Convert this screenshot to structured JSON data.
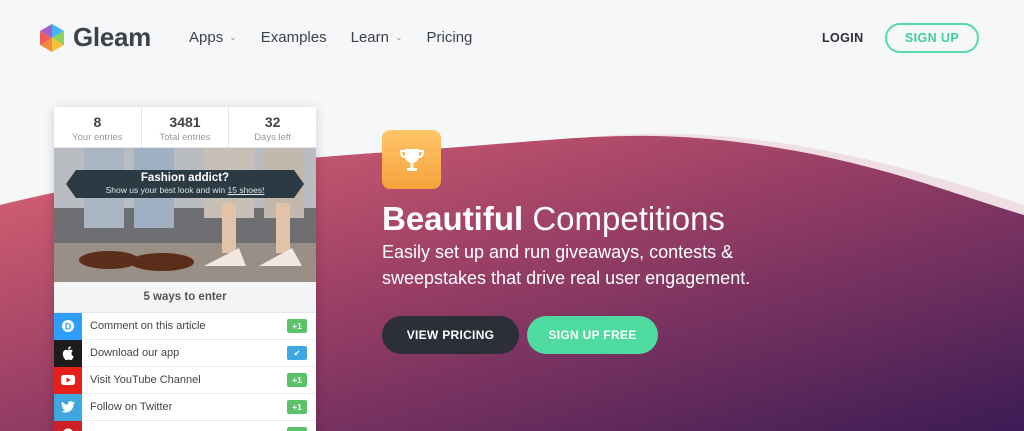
{
  "header": {
    "logo_text": "Gleam",
    "nav": [
      {
        "label": "Apps",
        "has_dropdown": true
      },
      {
        "label": "Examples",
        "has_dropdown": false
      },
      {
        "label": "Learn",
        "has_dropdown": true
      },
      {
        "label": "Pricing",
        "has_dropdown": false
      }
    ],
    "login_label": "LOGIN",
    "signup_label": "SIGN UP"
  },
  "widget": {
    "stats": [
      {
        "value": "8",
        "label": "Your entries"
      },
      {
        "value": "3481",
        "label": "Total entries"
      },
      {
        "value": "32",
        "label": "Days left"
      }
    ],
    "banner_title": "Fashion addict?",
    "banner_sub_prefix": "Show us your best look and win ",
    "banner_sub_link": "15 shoes!",
    "ways_label": "5 ways to enter",
    "entries": [
      {
        "label": "Comment on this article",
        "icon": "disqus-icon",
        "color": "#2e9fff",
        "badge": "+1",
        "badge_color": "#5cc269"
      },
      {
        "label": "Download our app",
        "icon": "apple-icon",
        "color": "#1c1c1c",
        "badge": "✔",
        "badge_color": "#3fa7e0"
      },
      {
        "label": "Visit YouTube Channel",
        "icon": "youtube-icon",
        "color": "#e62117",
        "badge": "+1",
        "badge_color": "#5cc269"
      },
      {
        "label": "Follow on Twitter",
        "icon": "twitter-icon",
        "color": "#3fa7e0",
        "badge": "+1",
        "badge_color": "#5cc269"
      },
      {
        "label": "",
        "icon": "pinterest-icon",
        "color": "#cb2027",
        "badge": "",
        "badge_color": "#5cc269"
      }
    ]
  },
  "hero": {
    "title_bold": "Beautiful",
    "title_light": " Competitions",
    "subtitle": "Easily set up and run giveaways, contests & sweepstakes that drive real user engagement.",
    "view_pricing_label": "VIEW PRICING",
    "signup_free_label": "SIGN UP FREE"
  },
  "colors": {
    "accent_green": "#4fdaa0",
    "dark_button": "#2c2f38",
    "trophy": "#f8b34f",
    "wave_start": "#d95f6e",
    "wave_end": "#3e1d52"
  }
}
